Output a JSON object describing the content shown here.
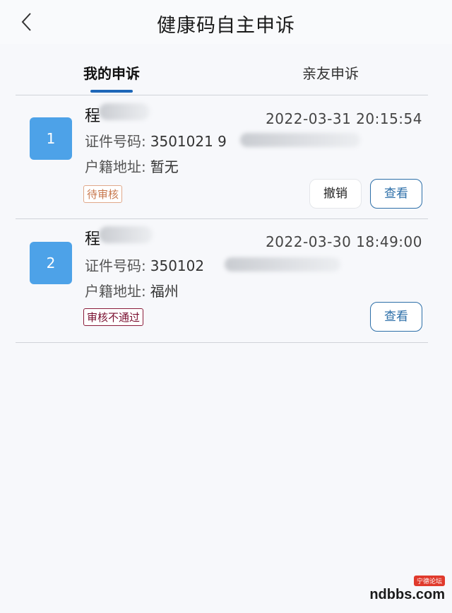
{
  "header": {
    "title": "健康码自主申诉",
    "back_icon": "chevron-left-icon"
  },
  "tabs": [
    {
      "label": "我的申诉",
      "active": true
    },
    {
      "label": "亲友申诉",
      "active": false
    }
  ],
  "appeals": [
    {
      "number": "1",
      "name": "程",
      "datetime": "2022-03-31 20:15:54",
      "id_label": "证件号码:",
      "id_value": "3501021 9",
      "addr_label": "户籍地址:",
      "addr_value": "暂无",
      "status": "待审核",
      "revoke_label": "撤销",
      "view_label": "查看"
    },
    {
      "number": "2",
      "name": "程",
      "datetime": "2022-03-30 18:49:00",
      "id_label": "证件号码:",
      "id_value": "350102",
      "addr_label": "户籍地址:",
      "addr_value": "福州",
      "status": "审核不通过",
      "view_label": "查看"
    }
  ],
  "watermark": {
    "tag": "宁德论坛",
    "logo": "ndbbs.com"
  },
  "colors": {
    "accent": "#1e67b8",
    "number_badge": "#4da2e8",
    "pending": "#c8794f",
    "rejected": "#7a1030"
  }
}
